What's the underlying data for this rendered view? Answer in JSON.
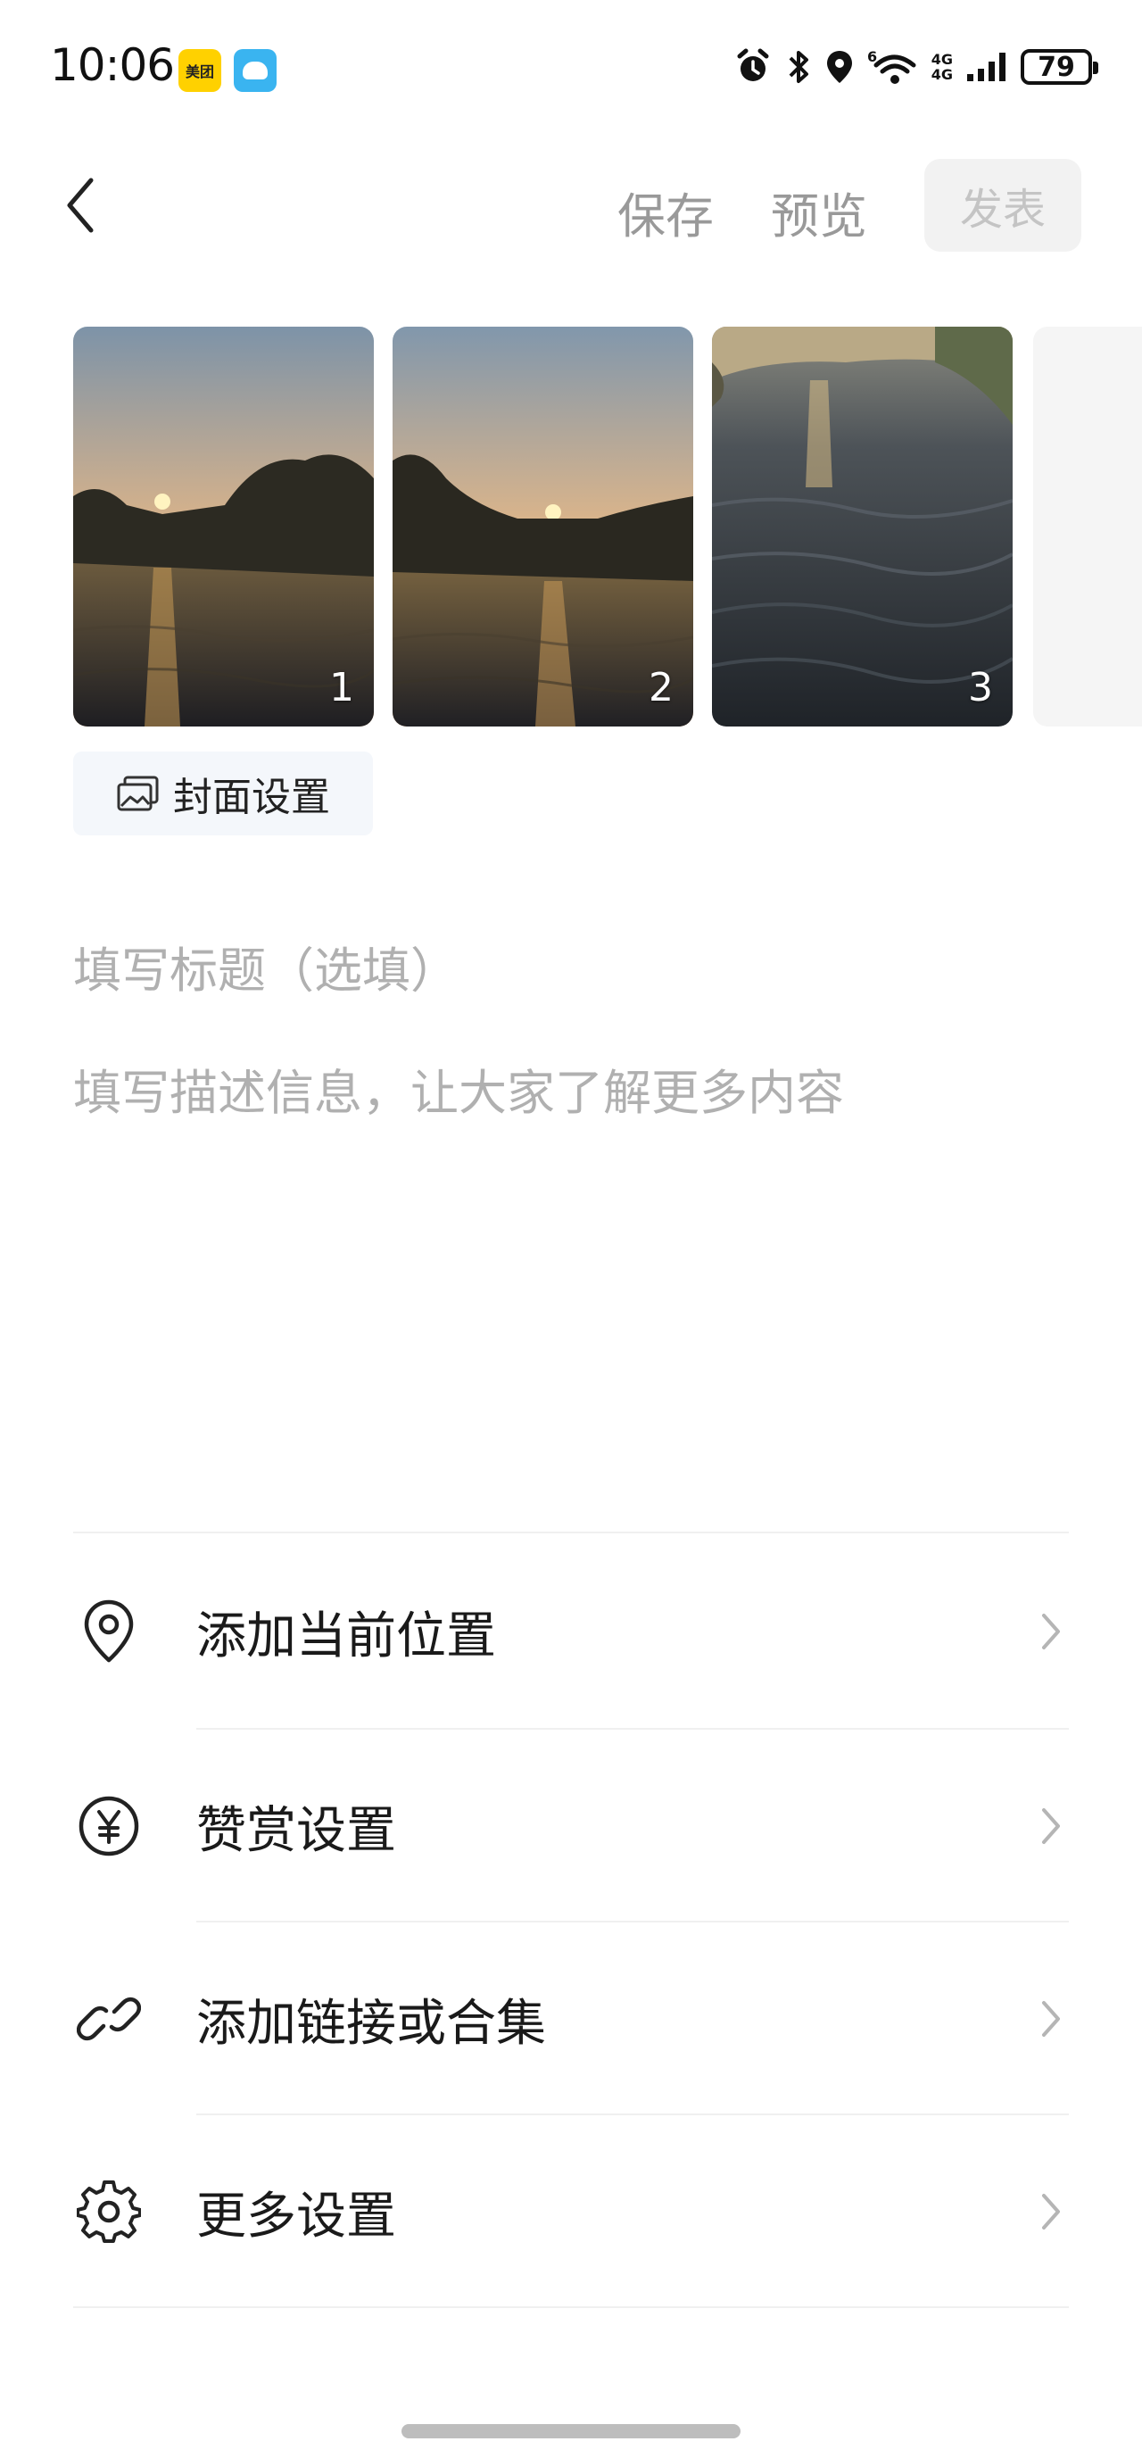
{
  "status_bar": {
    "time": "10:06",
    "meituan_badge": "美团",
    "network_top": "4G",
    "network_bottom": "4G",
    "wifi_badge": "6",
    "battery": "79"
  },
  "header": {
    "save": "保存",
    "preview": "预览",
    "publish": "发表"
  },
  "photos": [
    {
      "number": "1"
    },
    {
      "number": "2"
    },
    {
      "number": "3"
    }
  ],
  "cover_button": "封面设置",
  "title_placeholder": "填写标题（选填）",
  "description_placeholder": "填写描述信息，让大家了解更多内容",
  "settings": [
    {
      "label": "添加当前位置",
      "icon": "location-pin-icon"
    },
    {
      "label": "赞赏设置",
      "icon": "yen-coin-icon"
    },
    {
      "label": "添加链接或合集",
      "icon": "link-icon"
    },
    {
      "label": "更多设置",
      "icon": "gear-icon"
    }
  ],
  "colors": {
    "muted_text": "#999999",
    "placeholder_text": "#b0b0b0",
    "publish_disabled_bg": "#f2f2f2"
  }
}
